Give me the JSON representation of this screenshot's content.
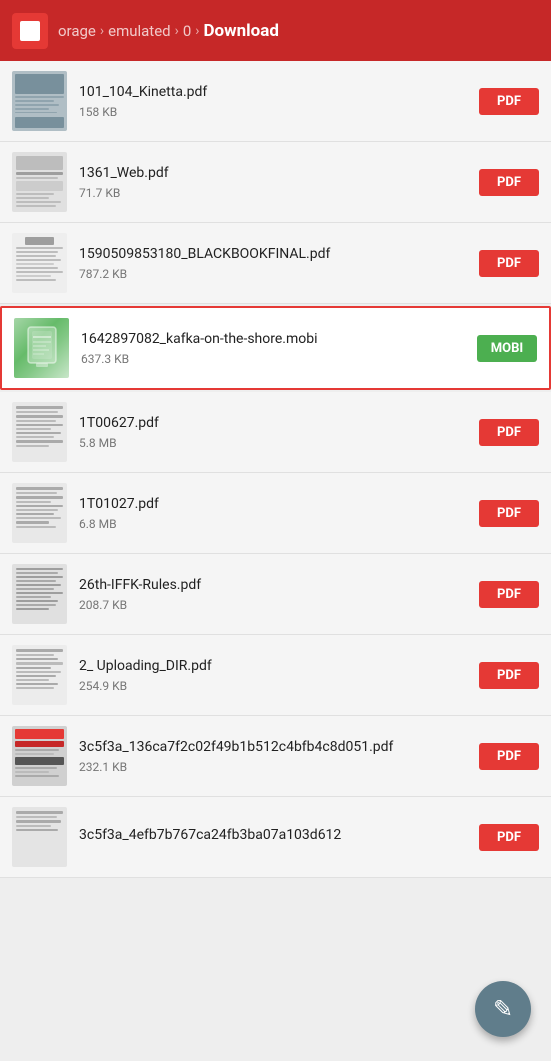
{
  "header": {
    "breadcrumb": [
      {
        "label": "orage",
        "active": false
      },
      {
        "label": "emulated",
        "active": false
      },
      {
        "label": "0",
        "active": false
      },
      {
        "label": "Download",
        "active": true
      }
    ]
  },
  "files": [
    {
      "id": "file-1",
      "name": "101_104_Kinetta.pdf",
      "size": "158 KB",
      "type": "PDF",
      "highlighted": false,
      "thumb_type": "photo"
    },
    {
      "id": "file-2",
      "name": "1361_Web.pdf",
      "size": "71.7 KB",
      "type": "PDF",
      "highlighted": false,
      "thumb_type": "lines"
    },
    {
      "id": "file-3",
      "name": "1590509853180_BLACKBOOKFINAL.pdf",
      "size": "787.2 KB",
      "type": "PDF",
      "highlighted": false,
      "thumb_type": "text"
    },
    {
      "id": "file-4",
      "name": "1642897082_kafka-on-the-shore.mobi",
      "size": "637.3 KB",
      "type": "MOBI",
      "highlighted": true,
      "thumb_type": "mobi"
    },
    {
      "id": "file-5",
      "name": "1T00627.pdf",
      "size": "5.8 MB",
      "type": "PDF",
      "highlighted": false,
      "thumb_type": "lines2"
    },
    {
      "id": "file-6",
      "name": "1T01027.pdf",
      "size": "6.8 MB",
      "type": "PDF",
      "highlighted": false,
      "thumb_type": "lines3"
    },
    {
      "id": "file-7",
      "name": "26th-IFFK-Rules.pdf",
      "size": "208.7 KB",
      "type": "PDF",
      "highlighted": false,
      "thumb_type": "dense"
    },
    {
      "id": "file-8",
      "name": "2_ Uploading_DIR.pdf",
      "size": "254.9 KB",
      "type": "PDF",
      "highlighted": false,
      "thumb_type": "lines4"
    },
    {
      "id": "file-9",
      "name": "3c5f3a_136ca7f2c02f49b1b512c4bfb4c8d051.pdf",
      "size": "232.1 KB",
      "type": "PDF",
      "highlighted": false,
      "thumb_type": "cover"
    },
    {
      "id": "file-10",
      "name": "3c5f3a_4efb7b767ca24fb3ba07a103d612",
      "size": "",
      "type": "PDF",
      "highlighted": false,
      "thumb_type": "lines5"
    }
  ],
  "fab": {
    "icon": "✎",
    "label": "edit"
  },
  "colors": {
    "header_bg": "#c62828",
    "badge_pdf": "#e53935",
    "badge_mobi": "#4caf50",
    "highlighted_border": "#e53935",
    "fab_bg": "#607d8b"
  }
}
